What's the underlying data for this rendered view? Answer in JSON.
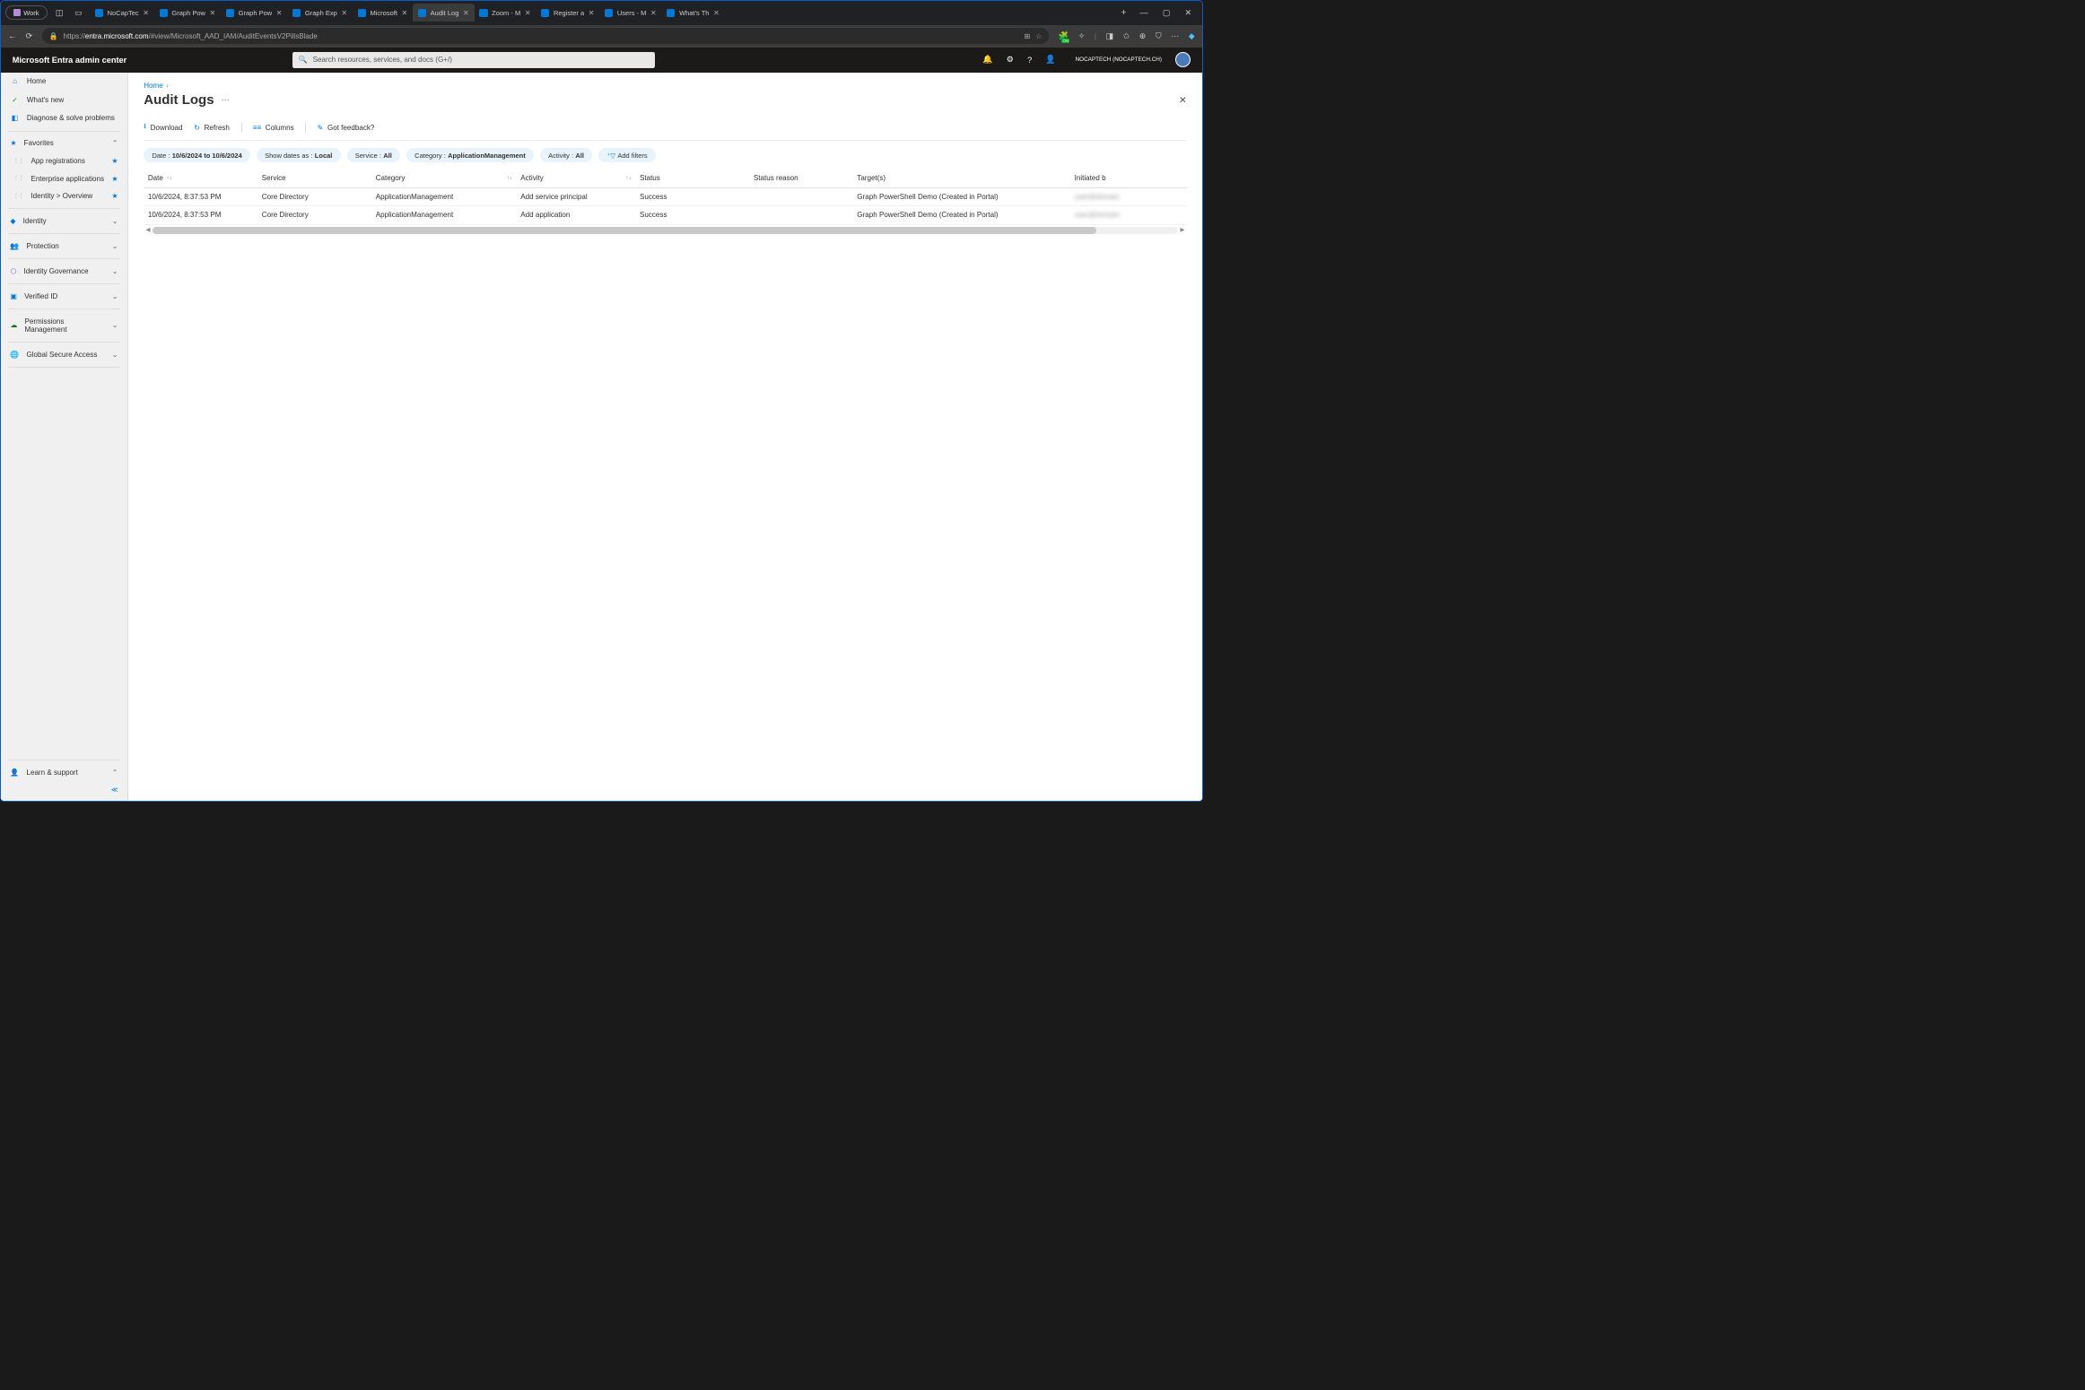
{
  "browser": {
    "work_label": "Work",
    "tabs": [
      {
        "label": "NoCapTec",
        "active": false
      },
      {
        "label": "Graph Pow",
        "active": false
      },
      {
        "label": "Graph Pow",
        "active": false
      },
      {
        "label": "Graph Exp",
        "active": false
      },
      {
        "label": "Microsoft",
        "active": false
      },
      {
        "label": "Audit Log",
        "active": true
      },
      {
        "label": "Zoom - M",
        "active": false
      },
      {
        "label": "Register a",
        "active": false
      },
      {
        "label": "Users - M",
        "active": false
      },
      {
        "label": "What's Th",
        "active": false
      }
    ],
    "url_prefix": "https://",
    "url_host": "entra.microsoft.com",
    "url_path": "/#view/Microsoft_AAD_IAM/AuditEventsV2PillsBlade"
  },
  "header": {
    "product": "Microsoft Entra admin center",
    "search_placeholder": "Search resources, services, and docs (G+/)",
    "tenant": "NOCAPTECH (NOCAPTECH.CH)"
  },
  "sidebar": {
    "home": "Home",
    "whatsnew": "What's new",
    "diagnose": "Diagnose & solve problems",
    "favorites": "Favorites",
    "fav_items": [
      "App registrations",
      "Enterprise applications",
      "Identity > Overview"
    ],
    "sections": [
      "Identity",
      "Protection",
      "Identity Governance",
      "Verified ID",
      "Permissions Management",
      "Global Secure Access"
    ],
    "learn": "Learn & support"
  },
  "page": {
    "breadcrumb_home": "Home",
    "title": "Audit Logs",
    "toolbar": {
      "download": "Download",
      "refresh": "Refresh",
      "columns": "Columns",
      "feedback": "Got feedback?"
    },
    "filters": {
      "date_label": "Date : ",
      "date_value": "10/6/2024 to 10/6/2024",
      "showdates_label": "Show dates as : ",
      "showdates_value": "Local",
      "service_label": "Service : ",
      "service_value": "All",
      "category_label": "Category : ",
      "category_value": "ApplicationManagement",
      "activity_label": "Activity : ",
      "activity_value": "All",
      "add": "Add filters"
    },
    "columns": [
      "Date",
      "Service",
      "Category",
      "Activity",
      "Status",
      "Status reason",
      "Target(s)",
      "Initiated b"
    ],
    "rows": [
      {
        "date": "10/6/2024, 8:37:53 PM",
        "service": "Core Directory",
        "category": "ApplicationManagement",
        "activity": "Add service principal",
        "status": "Success",
        "reason": "",
        "target": "Graph PowerShell Demo (Created in Portal)",
        "initiated": "user@domain"
      },
      {
        "date": "10/6/2024, 8:37:53 PM",
        "service": "Core Directory",
        "category": "ApplicationManagement",
        "activity": "Add application",
        "status": "Success",
        "reason": "",
        "target": "Graph PowerShell Demo (Created in Portal)",
        "initiated": "user@domain"
      }
    ]
  }
}
